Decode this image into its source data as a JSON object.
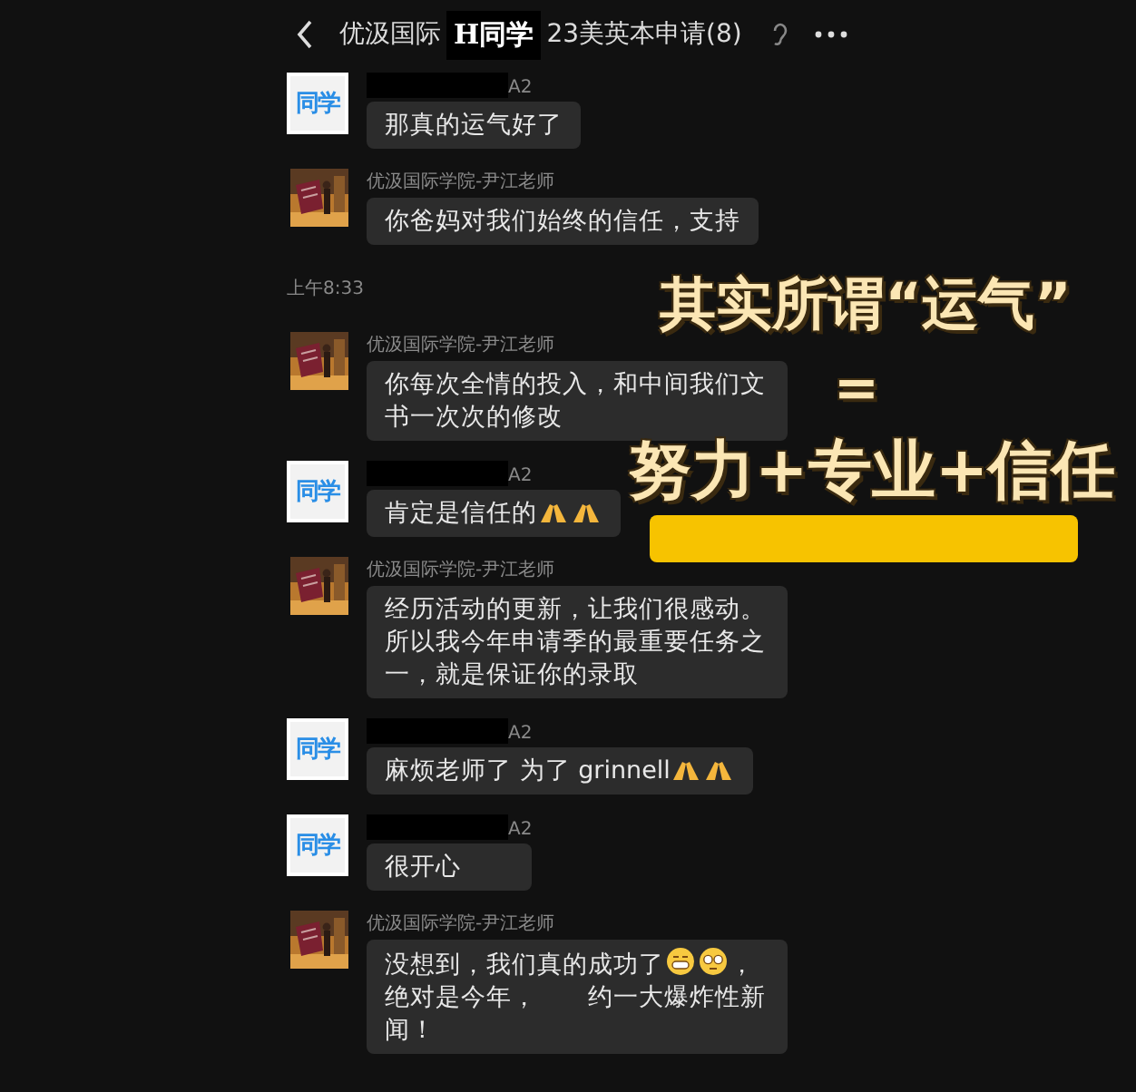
{
  "header": {
    "title_start": "优汲国际",
    "title_cover": "H同学",
    "title_end": "23美英本申请(8)"
  },
  "messages": [
    {
      "kind": "student",
      "avatar": "同学",
      "name": "A2",
      "segments": [
        {
          "kind": "text",
          "text": "那真的运气好了"
        }
      ]
    },
    {
      "kind": "teacher",
      "name": "优汲国际学院-尹江老师",
      "segments": [
        {
          "kind": "text",
          "text": "你爸妈对我们始终的信任，支持"
        }
      ]
    },
    {
      "kind": "time",
      "text": "上午8:33"
    },
    {
      "kind": "teacher",
      "name": "优汲国际学院-尹江老师",
      "segments": [
        {
          "kind": "text",
          "text": "你每次全情的投入，和中间我们文书一次次的修改"
        }
      ]
    },
    {
      "kind": "student",
      "avatar": "同学",
      "name": "A2",
      "segments": [
        {
          "kind": "text",
          "text": "肯定是信任的"
        },
        {
          "kind": "pray"
        },
        {
          "kind": "pray"
        }
      ]
    },
    {
      "kind": "teacher",
      "name": "优汲国际学院-尹江老师",
      "segments": [
        {
          "kind": "text",
          "text": "经历活动的更新，让我们很感动。所以我今年申请季的最重要任务之一，就是保证你的录取"
        }
      ]
    },
    {
      "kind": "student",
      "avatar": "同学",
      "name": "A2",
      "segments": [
        {
          "kind": "text",
          "text": "麻烦老师了 为了 grinnell"
        },
        {
          "kind": "pray"
        },
        {
          "kind": "pray"
        }
      ]
    },
    {
      "kind": "student",
      "avatar": "同学",
      "name": "A2",
      "segments": [
        {
          "kind": "text",
          "text": "很开心"
        }
      ]
    },
    {
      "kind": "teacher",
      "name": "优汲国际学院-尹江老师",
      "segments": [
        {
          "kind": "text",
          "text": "没想到，我们真的成功了"
        },
        {
          "kind": "grin"
        },
        {
          "kind": "disguise"
        },
        {
          "kind": "text",
          "text": "，绝对是今年，　　约一大爆炸性新闻！"
        }
      ]
    }
  ],
  "overlay": {
    "line_1": "其实所谓“运气”",
    "equals": "=",
    "line_2": "努力+专业+信任"
  }
}
